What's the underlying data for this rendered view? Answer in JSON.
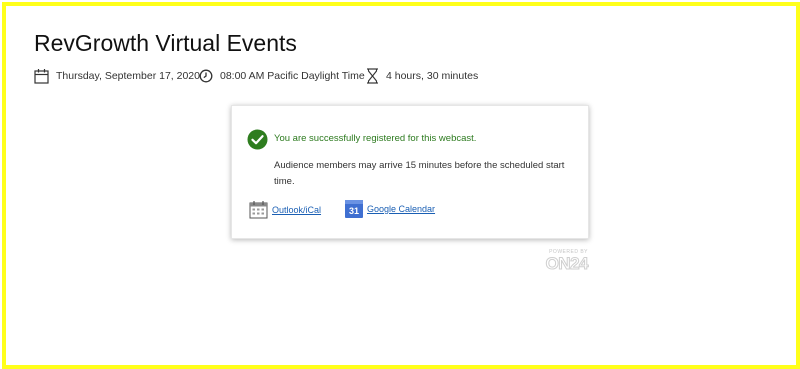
{
  "page": {
    "title": "RevGrowth Virtual Events"
  },
  "meta": {
    "date": "Thursday, September 17, 2020",
    "time": "08:00 AM Pacific Daylight Time",
    "duration": "4 hours, 30 minutes",
    "icons": [
      "calendar-icon",
      "clock-icon",
      "hourglass-icon"
    ]
  },
  "card": {
    "success_message": "You are successfully registered for this webcast.",
    "note": "Audience members may arrive 15 minutes before the scheduled start time.",
    "outlook_label": "Outlook/iCal",
    "google_label": "Google Calendar",
    "google_icon_day": "31"
  },
  "footer": {
    "powered_by": "POWERED BY",
    "brand": "ON24"
  },
  "colors": {
    "frame": "#ffff1a",
    "success": "#2c7a1e",
    "link": "#1a5fb4",
    "gcal": "#3f6fd1"
  }
}
